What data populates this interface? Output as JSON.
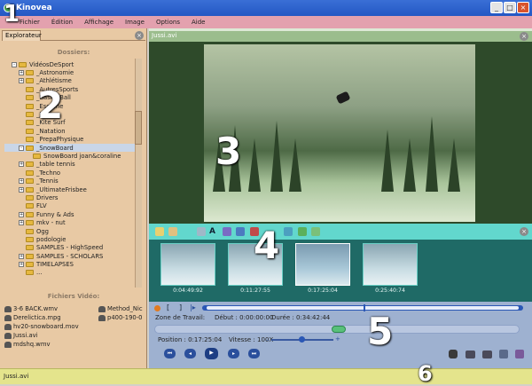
{
  "window": {
    "title": "Kinovea"
  },
  "menu": [
    "Fichier",
    "Édition",
    "Affichage",
    "Image",
    "Options",
    "Aide"
  ],
  "explorer": {
    "tab_label": "Explorateur",
    "folders_header": "Dossiers:",
    "tree": [
      {
        "label": "VidéosDeSport",
        "indent": 1,
        "expander": "-"
      },
      {
        "label": "_Astronomie",
        "indent": 2,
        "expander": "+"
      },
      {
        "label": "_Athlétisme",
        "indent": 2,
        "expander": "+"
      },
      {
        "label": "_AutresSports",
        "indent": 2,
        "expander": ""
      },
      {
        "label": "_BasketBall",
        "indent": 2,
        "expander": ""
      },
      {
        "label": "_Escrime",
        "indent": 2,
        "expander": ""
      },
      {
        "label": "_Judo",
        "indent": 2,
        "expander": ""
      },
      {
        "label": "_Kite Surf",
        "indent": 2,
        "expander": ""
      },
      {
        "label": "_Natation",
        "indent": 2,
        "expander": ""
      },
      {
        "label": "_PrepaPhysique",
        "indent": 2,
        "expander": ""
      },
      {
        "label": "_SnowBoard",
        "indent": 2,
        "expander": "-"
      },
      {
        "label": "SnowBoard joan&coraline",
        "indent": 3,
        "expander": ""
      },
      {
        "label": "_table tennis",
        "indent": 2,
        "expander": "+"
      },
      {
        "label": "_Techno",
        "indent": 2,
        "expander": ""
      },
      {
        "label": "_Tennis",
        "indent": 2,
        "expander": "+"
      },
      {
        "label": "_UltimateFrisbee",
        "indent": 2,
        "expander": "+"
      },
      {
        "label": "Drivers",
        "indent": 2,
        "expander": ""
      },
      {
        "label": "FLV",
        "indent": 2,
        "expander": ""
      },
      {
        "label": "Funny & Ads",
        "indent": 2,
        "expander": "+"
      },
      {
        "label": "mkv - nut",
        "indent": 2,
        "expander": "+"
      },
      {
        "label": "Ogg",
        "indent": 2,
        "expander": ""
      },
      {
        "label": "podologie",
        "indent": 2,
        "expander": ""
      },
      {
        "label": "SAMPLES - HighSpeed",
        "indent": 2,
        "expander": ""
      },
      {
        "label": "SAMPLES - SCHOLARS",
        "indent": 2,
        "expander": "+"
      },
      {
        "label": "TIMELAPSES",
        "indent": 2,
        "expander": "+"
      },
      {
        "label": "...",
        "indent": 2,
        "expander": ""
      }
    ],
    "files_header": "Fichiers Vidéo:",
    "files_col1": [
      "3-6 BACK.wmv",
      "Derelictica.mpg",
      "hv20-snowboard.mov",
      "Jussi.avi",
      "mdshq.wmv"
    ],
    "files_col2": [
      "Method_Nic",
      "p400-190-0"
    ]
  },
  "video": {
    "title": "Jussi.avi"
  },
  "thumbnails": [
    {
      "time": "0:04:49:92"
    },
    {
      "time": "0:11:27:55"
    },
    {
      "time": "0:17:25:04"
    },
    {
      "time": "0:25:40:74"
    }
  ],
  "selected_thumbnail": 2,
  "player": {
    "work_zone_label": "Zone de Travail:",
    "start_label": "Début : 0:00:00:00",
    "duration_label": "Durée : 0:34:42:44",
    "position_label": "Position : 0:17:25:04",
    "speed_label": "Vitesse : 100X",
    "position_fraction": 0.5
  },
  "status": {
    "text": "Jussi.avi"
  },
  "overlay_numbers": [
    "1",
    "2",
    "3",
    "4",
    "5",
    "6"
  ],
  "colors": {
    "menu_bg": "#e3a1ae",
    "explorer_bg": "#e8c9a4",
    "video_bg": "#2e4a2a",
    "tools_bg": "#1f6a66",
    "toolbar_bg": "#62d7cd",
    "player_bg": "#9eb1d0",
    "status_bg": "#e4e48c"
  }
}
